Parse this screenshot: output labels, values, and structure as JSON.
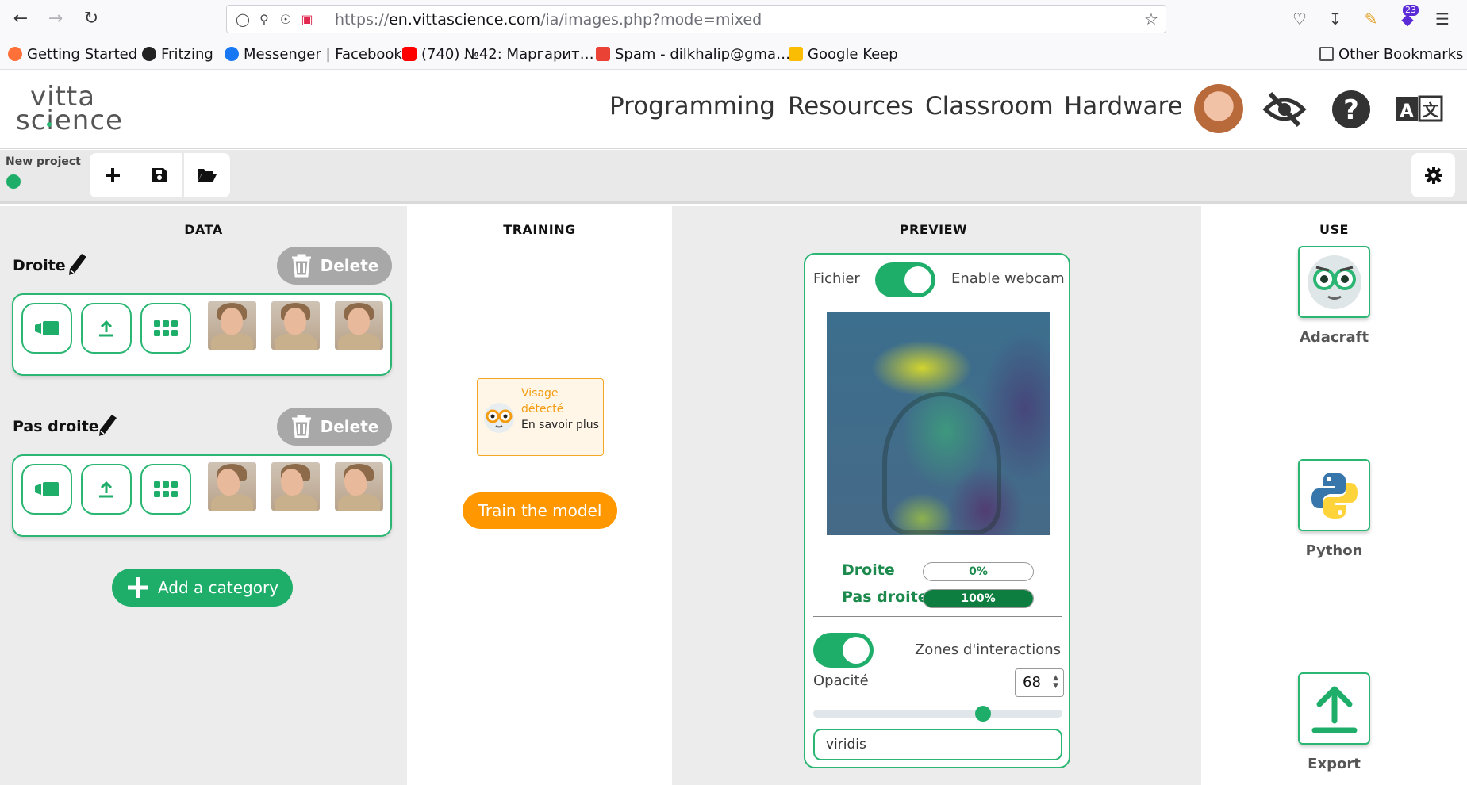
{
  "browser": {
    "url_prefix": "https://",
    "url_host": "en.vittascience.com",
    "url_path": "/ia/images.php?mode=mixed",
    "extension_badge": "23",
    "bookmarks": [
      {
        "label": "Getting Started",
        "icon": "firefox-icon",
        "color": "#ff7139"
      },
      {
        "label": "Fritzing",
        "icon": "github-icon",
        "color": "#222222"
      },
      {
        "label": "Messenger | Facebook",
        "icon": "facebook-icon",
        "color": "#1877f2"
      },
      {
        "label": "(740) №42: Маргарит…",
        "icon": "youtube-icon",
        "color": "#ff0000"
      },
      {
        "label": "Spam - dilkhalip@gma…",
        "icon": "gmail-icon",
        "color": "#ea4335"
      },
      {
        "label": "Google Keep",
        "icon": "keep-icon",
        "color": "#fbbc04"
      }
    ],
    "other_bookmarks": "Other Bookmarks"
  },
  "site": {
    "logo_line1": "vitta",
    "logo_line2": "science",
    "menu": [
      "Programming",
      "Resources",
      "Classroom",
      "Hardware"
    ],
    "accent": "#2bb673"
  },
  "project": {
    "name": "New project"
  },
  "data_col": {
    "title": "DATA",
    "delete_label": "Delete",
    "categories": [
      {
        "name": "Droite"
      },
      {
        "name": "Pas droite"
      }
    ],
    "add_category": "Add a category"
  },
  "training_col": {
    "title": "TRAINING",
    "visage_line1": "Visage détecté",
    "visage_line2": "En savoir plus",
    "train_button": "Train the model"
  },
  "preview_col": {
    "title": "PREVIEW",
    "file_label": "Fichier",
    "webcam_label": "Enable webcam",
    "predictions": [
      {
        "label": "Droite",
        "value": 0,
        "text": "0%"
      },
      {
        "label": "Pas droite",
        "value": 100,
        "text": "100%"
      }
    ],
    "zones_label": "Zones d'interactions",
    "opacity_label": "Opacité",
    "opacity_value": "68",
    "opacity_fraction": 0.68,
    "colormap": "viridis"
  },
  "use_col": {
    "title": "USE",
    "items": [
      "Adacraft",
      "Python",
      "Export"
    ]
  }
}
